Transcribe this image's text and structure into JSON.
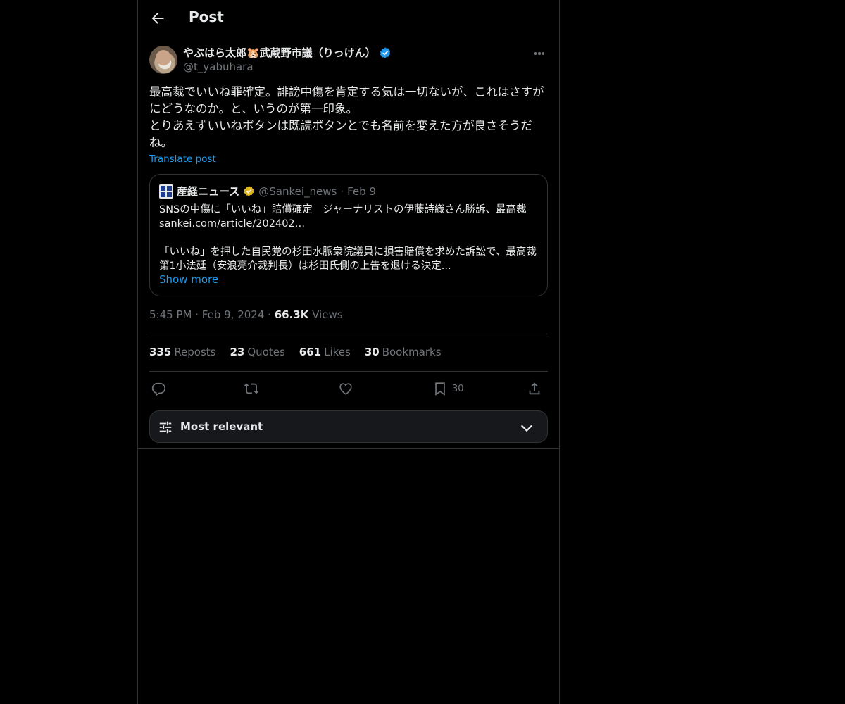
{
  "header": {
    "title": "Post"
  },
  "author": {
    "name": "やぶはら太郎🐹武蔵野市議（りっけん）",
    "handle": "@t_yabuhara"
  },
  "post": {
    "text": "最高裁でいいね罪確定。誹謗中傷を肯定する気は一切ないが、これはさすがにどうなのか。と、いうのが第一印象。\nとりあえずいいねボタンは既読ボタンとでも名前を変えた方が良さそうだね。",
    "translate_label": "Translate post"
  },
  "quote": {
    "name": "産経ニュース",
    "handle": "@Sankei_news",
    "separator": "·",
    "date": "Feb 9",
    "text": "SNSの中傷に「いいね」賠償確定　ジャーナリストの伊藤詩織さん勝訴、最高裁\nsankei.com/article/202402…\n\n「いいね」を押した自民党の杉田水脈衆院議員に損害賠償を求めた訴訟で、最高裁第1小法廷（安浪亮介裁判長）は杉田氏側の上告を退ける決定...",
    "show_more": "Show more"
  },
  "meta": {
    "time": "5:45 PM",
    "sep1": "·",
    "date": "Feb 9, 2024",
    "sep2": "·",
    "views_count": "66.3K",
    "views_label": "Views"
  },
  "stats": {
    "reposts_count": "335",
    "reposts_label": "Reposts",
    "quotes_count": "23",
    "quotes_label": "Quotes",
    "likes_count": "661",
    "likes_label": "Likes",
    "bookmarks_count": "30",
    "bookmarks_label": "Bookmarks"
  },
  "actions": {
    "bookmark_count": "30"
  },
  "sort": {
    "label": "Most relevant"
  },
  "colors": {
    "background": "#000000",
    "text": "#e7e9ea",
    "muted": "#71767b",
    "accent": "#1d9bf0",
    "border": "#2f3336",
    "gold_badge": "#e2b719"
  }
}
